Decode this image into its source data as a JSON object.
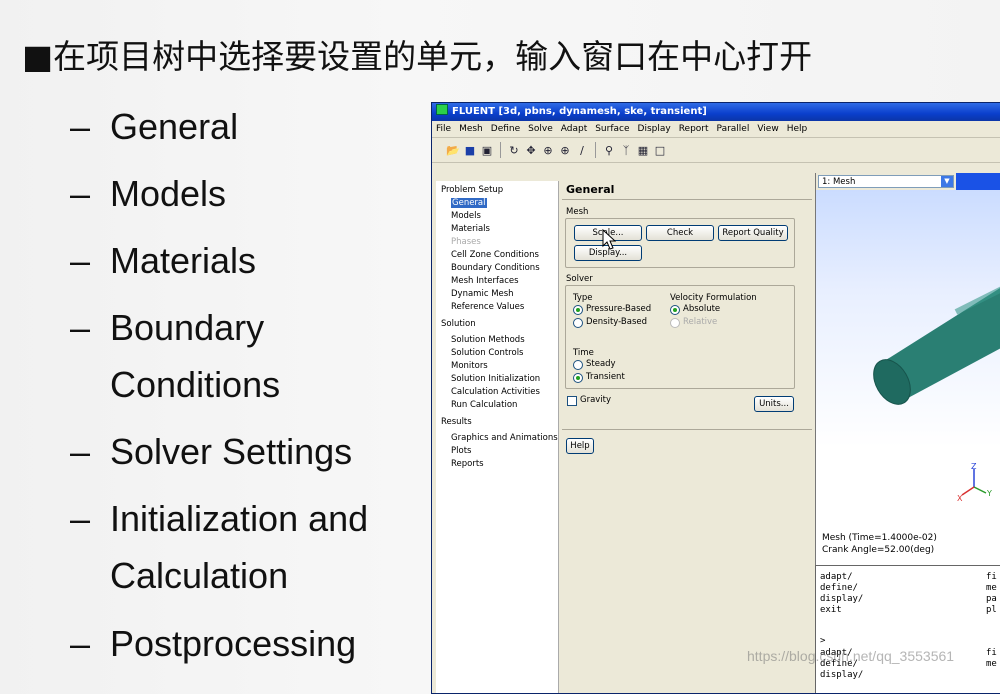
{
  "slide": {
    "title": "■在项目树中选择要设置的单元，输入窗口在中心打开",
    "bullets": [
      {
        "dash": "–",
        "line1": "General",
        "line2": ""
      },
      {
        "dash": "–",
        "line1": "Models",
        "line2": ""
      },
      {
        "dash": "–",
        "line1": "Materials",
        "line2": ""
      },
      {
        "dash": "–",
        "line1": "Boundary",
        "line2": "Conditions"
      },
      {
        "dash": "–",
        "line1": "Solver  Settings",
        "line2": ""
      },
      {
        "dash": "–",
        "line1": "Initialization  and",
        "line2": "Calculation"
      },
      {
        "dash": "–",
        "line1": "Postprocessing",
        "line2": ""
      }
    ]
  },
  "window": {
    "title": "FLUENT  [3d, pbns, dynamesh, ske, transient]",
    "menu": [
      "File",
      "Mesh",
      "Define",
      "Solve",
      "Adapt",
      "Surface",
      "Display",
      "Report",
      "Parallel",
      "View",
      "Help"
    ],
    "toolbar_icons": [
      "open-icon",
      "save-icon",
      "camera-icon",
      "rotate-icon",
      "pan-icon",
      "zoom-in-icon",
      "zoom-box-icon",
      "probe-icon",
      "magnify-icon",
      "axes-icon",
      "layout-icon",
      "window-icon"
    ]
  },
  "tree": {
    "problem_setup": "Problem Setup",
    "general": "General",
    "models": "Models",
    "materials": "Materials",
    "phases": "Phases",
    "cell_zone": "Cell Zone Conditions",
    "boundary": "Boundary Conditions",
    "mesh_interfaces": "Mesh Interfaces",
    "dynamic_mesh": "Dynamic Mesh",
    "reference_values": "Reference Values",
    "solution": "Solution",
    "solution_methods": "Solution Methods",
    "solution_controls": "Solution Controls",
    "monitors": "Monitors",
    "solution_init": "Solution Initialization",
    "calc_activities": "Calculation Activities",
    "run_calc": "Run Calculation",
    "results": "Results",
    "graphics": "Graphics and Animations",
    "plots": "Plots",
    "reports": "Reports"
  },
  "panel": {
    "title": "General",
    "mesh_label": "Mesh",
    "scale_btn": "Scale...",
    "check_btn": "Check",
    "report_quality_btn": "Report Quality",
    "display_btn": "Display...",
    "solver_label": "Solver",
    "type_label": "Type",
    "pressure_based": "Pressure-Based",
    "density_based": "Density-Based",
    "velocity_label": "Velocity Formulation",
    "absolute": "Absolute",
    "relative": "Relative",
    "time_label": "Time",
    "steady": "Steady",
    "transient": "Transient",
    "gravity": "Gravity",
    "units_btn": "Units...",
    "help_btn": "Help"
  },
  "graphics": {
    "dropdown": "1: Mesh",
    "mesh_info": "Mesh  (Time=1.4000e-02)",
    "crank": "Crank Angle=52.00(deg)",
    "axis_z": "Z",
    "axis_y": "Y",
    "axis_x": "X"
  },
  "console": {
    "lines_left": [
      "adapt/",
      "define/",
      "display/",
      "exit",
      "",
      ">",
      "adapt/",
      "define/",
      "display/"
    ],
    "lines_right": [
      "fi",
      "me",
      "pa",
      "pl",
      "",
      "",
      "fi",
      "me",
      ""
    ]
  },
  "watermark": "https://blog.csdn.net/qq_3553561",
  "colors": {
    "titlebar": "#0a3fcc",
    "selection": "#316ac5",
    "mesh_body": "#2a7f73"
  }
}
